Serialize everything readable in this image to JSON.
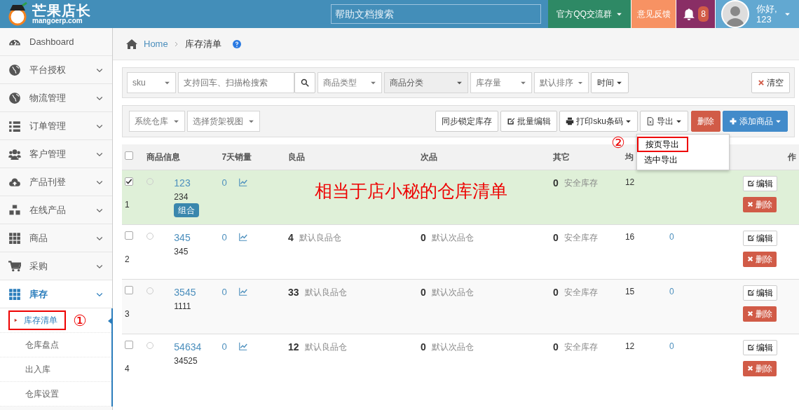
{
  "header": {
    "brand": "芒果店长",
    "domain": "mangoerp.com",
    "search": {
      "placeholder": "帮助文档搜索"
    },
    "qq_group": "官方QQ交流群",
    "feedback": "意见反馈",
    "notifications": "8",
    "greeting": "你好,",
    "user": "123"
  },
  "sidebar": {
    "items": [
      {
        "kind": "link",
        "label": "Dashboard",
        "selected": false
      },
      {
        "kind": "menu",
        "label": "平台授权",
        "selected": false
      },
      {
        "kind": "menu",
        "label": "物流管理",
        "selected": false
      },
      {
        "kind": "menu",
        "label": "订单管理",
        "selected": false
      },
      {
        "kind": "menu",
        "label": "客户管理",
        "selected": false
      },
      {
        "kind": "menu",
        "label": "产品刊登",
        "selected": false
      },
      {
        "kind": "menu",
        "label": "在线产品",
        "selected": false
      },
      {
        "kind": "menu",
        "label": "商品",
        "selected": false
      },
      {
        "kind": "menu",
        "label": "采购",
        "selected": false
      },
      {
        "kind": "menu",
        "label": "库存",
        "selected": true,
        "children": [
          {
            "label": "库存清单",
            "selected": true,
            "annotation": "①"
          },
          {
            "label": "仓库盘点",
            "selected": false
          },
          {
            "label": "出入库",
            "selected": false
          },
          {
            "label": "仓库设置",
            "selected": false
          }
        ]
      }
    ]
  },
  "breadcrumb": {
    "home": "Home",
    "current": "库存清单"
  },
  "filters": {
    "field": "sku",
    "search_placeholder": "支持回车、扫描枪搜索",
    "selects": [
      {
        "label": "商品类型",
        "kind": "plain"
      },
      {
        "label": "商品分类",
        "kind": "shaded"
      },
      {
        "label": "库存量",
        "kind": "plain"
      },
      {
        "label": "默认排序",
        "kind": "plain"
      }
    ],
    "time": "时间",
    "clear": "清空"
  },
  "toolbar": {
    "selects": [
      "系统仓库",
      "选择货架视图"
    ],
    "buttons": [
      {
        "label": "同步锁定库存",
        "kind": "plain",
        "caret": false
      },
      {
        "label": "批量编辑",
        "kind": "edit",
        "caret": false
      },
      {
        "label": "打印sku条码",
        "kind": "print",
        "caret": true
      },
      {
        "label": "导出",
        "kind": "export",
        "caret": true
      },
      {
        "label": "删除",
        "kind": "danger",
        "caret": false
      },
      {
        "label": "添加商品",
        "kind": "primary",
        "caret": true
      }
    ],
    "export_menu": {
      "annotation": "②",
      "items": [
        {
          "label": "按页导出",
          "selected": true
        },
        {
          "label": "选中导出",
          "selected": false
        }
      ]
    }
  },
  "table": {
    "select_all": false,
    "columns": [
      "商品信息",
      "7天销量",
      "良品",
      "次品",
      "其它",
      "均",
      "作"
    ],
    "rows": [
      {
        "selected": true,
        "radio": false,
        "index": "1",
        "sku": "123",
        "name": "234",
        "tag": "组合",
        "sales": "0",
        "other_qty": "0",
        "other_store": "安全库存",
        "column_6": "12",
        "edit": "编辑",
        "delete": "删除"
      },
      {
        "selected": false,
        "radio": false,
        "index": "2",
        "sku": "345",
        "name": "345",
        "sales": "0",
        "good_qty": "4",
        "good_store": "默认良品仓",
        "bad_qty": "0",
        "bad_store": "默认次品仓",
        "other_qty": "0",
        "other_store": "安全库存",
        "column_6": "16",
        "column_7": "0",
        "edit": "编辑",
        "delete": "删除"
      },
      {
        "selected": false,
        "radio": false,
        "index": "3",
        "sku": "3545",
        "name": "1111",
        "sales": "0",
        "good_qty": "33",
        "good_store": "默认良品仓",
        "bad_qty": "0",
        "bad_store": "默认次品仓",
        "other_qty": "0",
        "other_store": "安全库存",
        "column_6": "15",
        "column_7": "0",
        "edit": "编辑",
        "delete": "删除"
      },
      {
        "selected": false,
        "radio": false,
        "index": "4",
        "sku": "54634",
        "name": "34525",
        "sales": "0",
        "good_qty": "12",
        "good_store": "默认良品仓",
        "bad_qty": "0",
        "bad_store": "默认次品仓",
        "other_qty": "0",
        "other_store": "安全库存",
        "column_6": "12",
        "column_7": "0",
        "edit": "编辑",
        "delete": "删除"
      }
    ],
    "annotation": "相当于店小秘的仓库清单"
  }
}
